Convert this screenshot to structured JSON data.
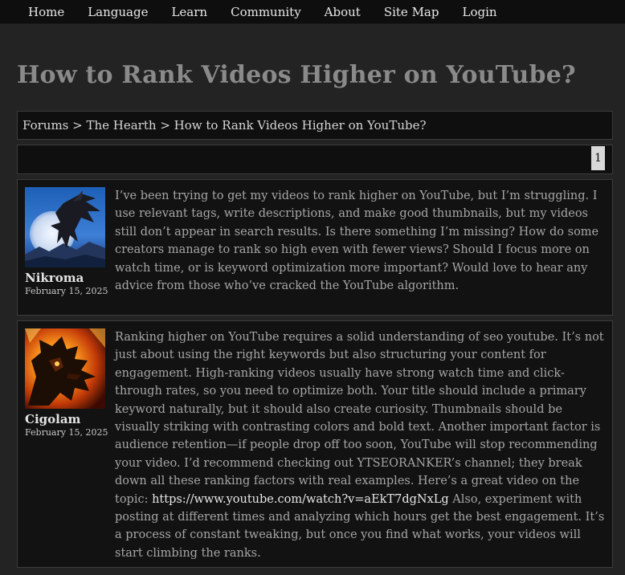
{
  "nav": {
    "items": [
      "Home",
      "Language",
      "Learn",
      "Community",
      "About",
      "Site Map",
      "Login"
    ]
  },
  "page": {
    "title": "How to Rank Videos Higher on YouTube?"
  },
  "breadcrumb": {
    "text": "Forums > The Hearth > How to Rank Videos Higher on YouTube?"
  },
  "pagination": {
    "current": "1"
  },
  "posts": [
    {
      "author": "Nikroma",
      "date": "February 15, 2025",
      "avatar": "dragon-moon-avatar",
      "body": "I’ve been trying to get my videos to rank higher on YouTube, but I’m struggling. I use relevant tags, write descriptions, and make good thumbnails, but my videos still don’t appear in search results. Is there something I’m missing? How do some creators manage to rank so high even with fewer views? Should I focus more on watch time, or is keyword optimization more important? Would love to hear any advice from those who’ve cracked the YouTube algorithm."
    },
    {
      "author": "Cigolam",
      "date": "February 15, 2025",
      "avatar": "dragon-fire-avatar",
      "body_before": "Ranking higher on YouTube requires a solid understanding of seo youtube. It’s not just about using the right keywords but also structuring your content for engagement. High-ranking videos usually have strong watch time and click-through rates, so you need to optimize both. Your title should include a primary keyword naturally, but it should also create curiosity. Thumbnails should be visually striking with contrasting colors and bold text. Another important factor is audience retention—if people drop off too soon, YouTube will stop recommending your video. I’d recommend checking out YTSEORANKER’s channel; they break down all these ranking factors with real examples. Here’s a great video on the topic: ",
      "link": "https://www.youtube.com/watch?v=aEkT7dgNxLg",
      "body_after": " Also, experiment with posting at different times and analyzing which hours get the best engagement. It’s a process of constant tweaking, but once you find what works, your videos will start climbing the ranks."
    }
  ]
}
